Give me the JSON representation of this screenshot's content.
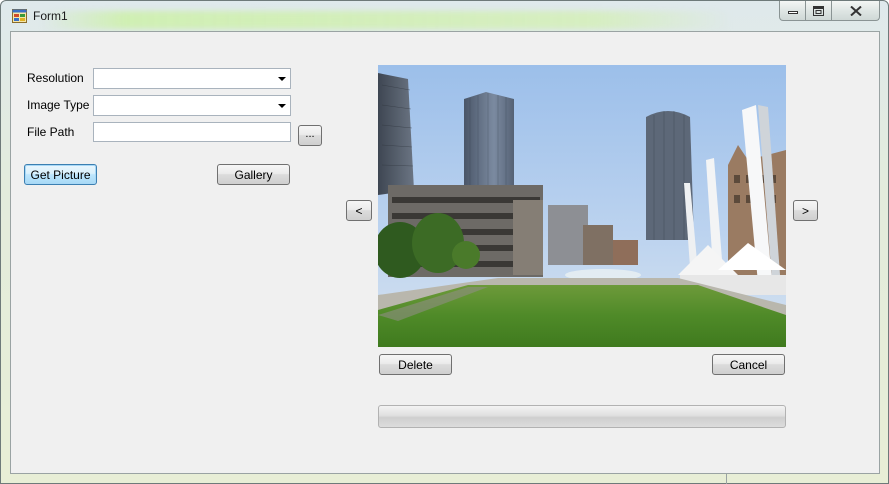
{
  "window": {
    "title": "Form1"
  },
  "form": {
    "resolution": {
      "label": "Resolution",
      "value": ""
    },
    "image_type": {
      "label": "Image Type",
      "value": ""
    },
    "file_path": {
      "label": "File Path",
      "value": ""
    },
    "browse_label": "...",
    "get_picture_label": "Get Picture",
    "gallery_label": "Gallery"
  },
  "viewer": {
    "prev_label": "<",
    "next_label": ">",
    "delete_label": "Delete",
    "cancel_label": "Cancel",
    "progress": 0
  },
  "icons": {
    "app": "windows-form-icon",
    "minimize": "minimize-icon",
    "maximize": "maximize-icon",
    "close": "close-icon",
    "dropdown": "chevron-down-icon"
  }
}
